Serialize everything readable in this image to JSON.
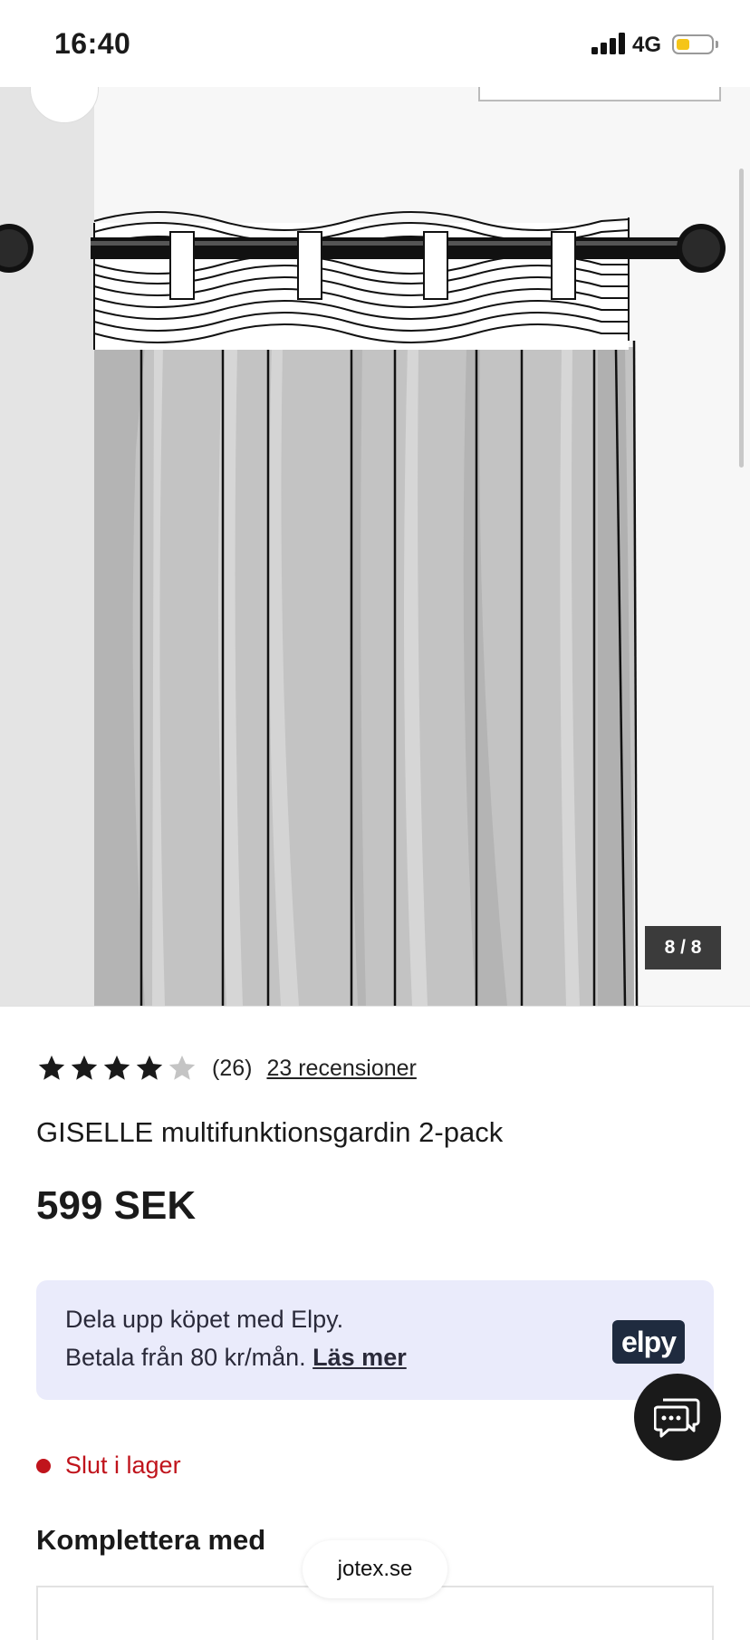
{
  "status_bar": {
    "time": "16:40",
    "network": "4G",
    "battery_level": 0.35,
    "battery_color": "#f5c518"
  },
  "gallery": {
    "counter": "8 / 8",
    "image_subject": "curtain-illustration"
  },
  "product": {
    "rating_value": 4,
    "rating_max": 5,
    "rating_count": "(26)",
    "reviews_link": "23 recensioner",
    "title": "GISELLE multifunktionsgardin 2-pack",
    "price": "599 SEK"
  },
  "elpy": {
    "line1": "Dela upp köpet med Elpy.",
    "line2_prefix": "Betala från 80 kr/mån.",
    "read_more": "Läs mer",
    "logo": "elpy",
    "background": "#eaebfb"
  },
  "stock": {
    "status": "Slut i lager",
    "color": "#c0141c"
  },
  "sections": {
    "complement_heading": "Komplettera med"
  },
  "browser": {
    "domain": "jotex.se"
  },
  "icons": {
    "chat": "chat-bubbles-icon",
    "star": "star-icon",
    "back": "chevron-left-icon"
  }
}
